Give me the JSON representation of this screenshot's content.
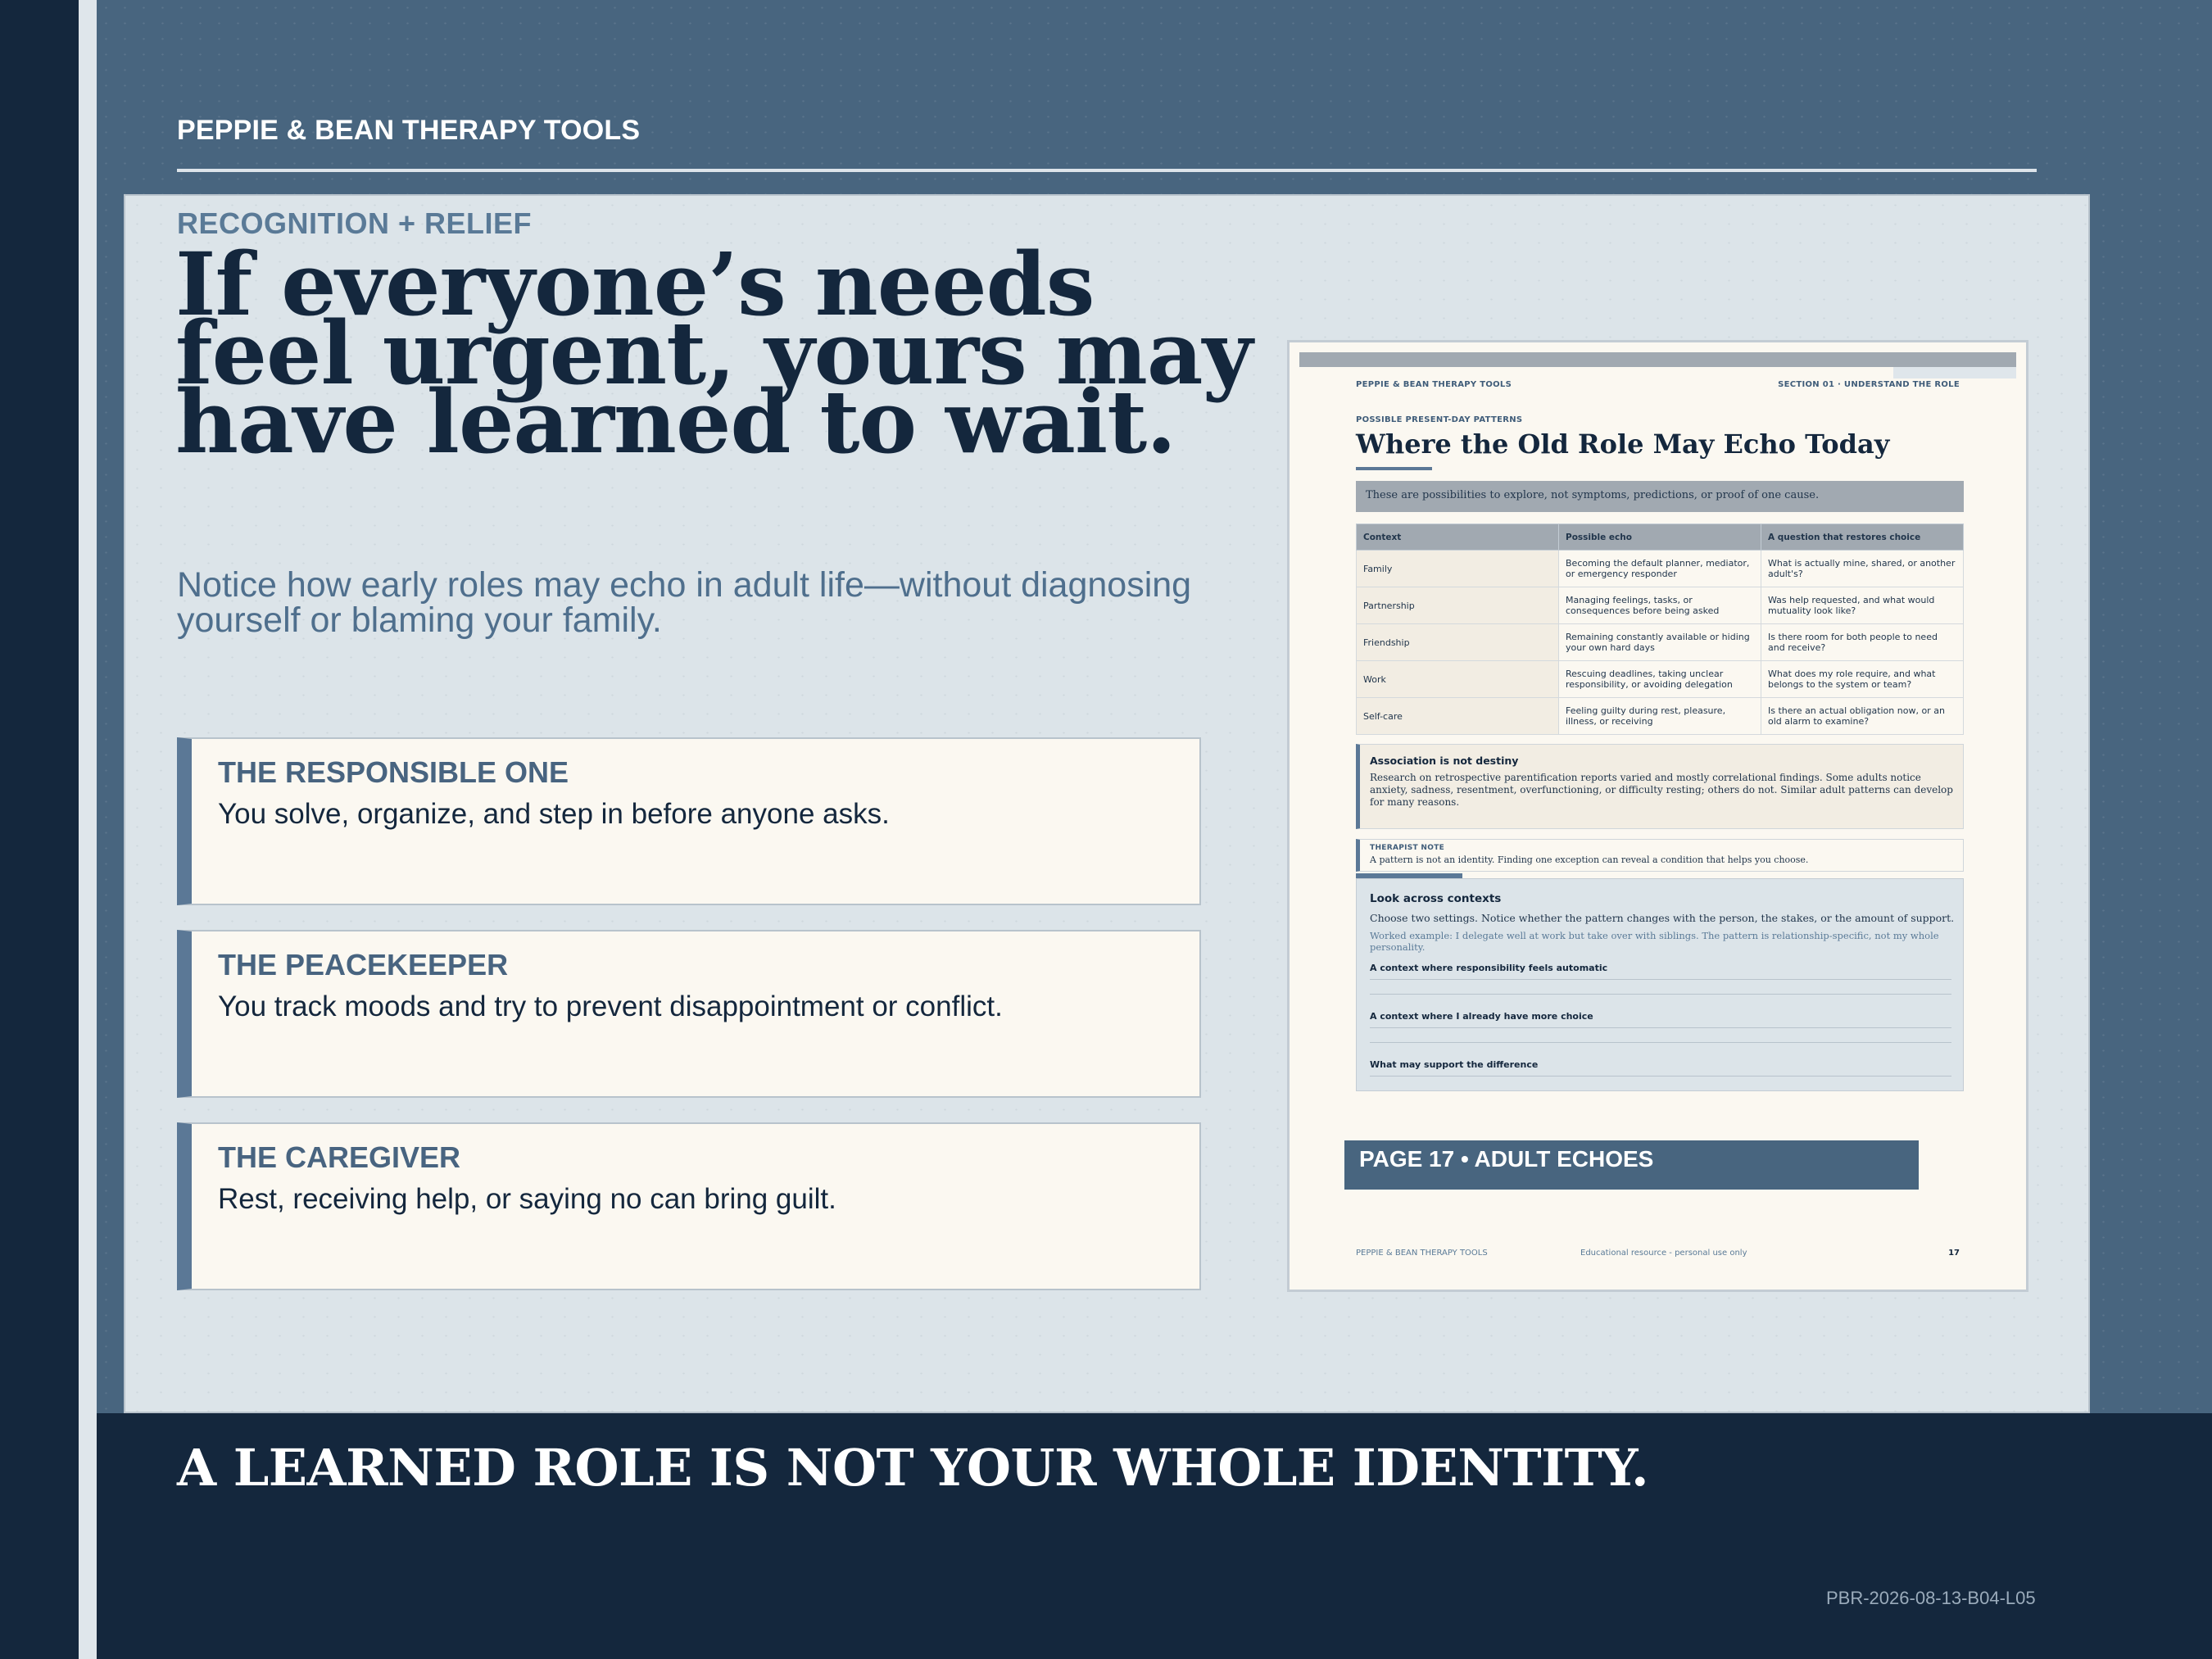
{
  "brand": "PEPPIE & BEAN THERAPY TOOLS",
  "kicker": "RECOGNITION + RELIEF",
  "headline": "If everyone’s needs feel urgent, yours may have learned to wait.",
  "subhead": "Notice how early roles may echo in adult life—without diagnosing yourself or blaming your family.",
  "cards": [
    {
      "title": "THE RESPONSIBLE ONE",
      "text": "You solve, organize, and step in before anyone asks."
    },
    {
      "title": "THE PEACEKEEPER",
      "text": "You track moods and try to prevent disappointment or conflict."
    },
    {
      "title": "THE CAREGIVER",
      "text": "Rest, receiving help, or saying no can bring guilt."
    }
  ],
  "doc": {
    "header_left": "PEPPIE & BEAN THERAPY TOOLS",
    "header_right": "SECTION 01 · UNDERSTAND THE ROLE",
    "eyebrow": "POSSIBLE PRESENT-DAY PATTERNS",
    "title": "Where the Old Role May Echo Today",
    "note": "These are possibilities to explore, not symptoms, predictions, or proof of one cause.",
    "table_headers": [
      "Context",
      "Possible echo",
      "A question that restores choice"
    ],
    "table_rows": [
      [
        "Family",
        "Becoming the default planner, mediator, or emergency responder",
        "What is actually mine, shared, or another adult's?"
      ],
      [
        "Partnership",
        "Managing feelings, tasks, or consequences before being asked",
        "Was help requested, and what would mutuality look like?"
      ],
      [
        "Friendship",
        "Remaining constantly available or hiding your own hard days",
        "Is there room for both people to need and receive?"
      ],
      [
        "Work",
        "Rescuing deadlines, taking unclear responsibility, or avoiding delegation",
        "What does my role require, and what belongs to the system or team?"
      ],
      [
        "Self-care",
        "Feeling guilty during rest, pleasure, illness, or receiving",
        "Is there an actual obligation now, or an old alarm to examine?"
      ]
    ],
    "association_title": "Association is not destiny",
    "association_body": "Research on retrospective parentification reports varied and mostly correlational findings. Some adults notice anxiety, sadness, resentment, overfunctioning, or difficulty resting; others do not. Similar adult patterns can develop for many reasons.",
    "therapist_label": "THERAPIST NOTE",
    "therapist_body": "A pattern is not an identity. Finding one exception can reveal a condition that helps you choose.",
    "look_title": "Look across contexts",
    "look_body": "Choose two settings. Notice whether the pattern changes with the person, the stakes, or the amount of support.",
    "look_example": "Worked example: I delegate well at work but take over with siblings. The pattern is relationship-specific, not my whole personality.",
    "prompts": [
      "A context where responsibility feels automatic",
      "A context where I already have more choice",
      "What may support the difference"
    ],
    "page_bar": "PAGE 17 • ADULT ECHOES",
    "footer_left": "PEPPIE & BEAN THERAPY TOOLS",
    "footer_center": "Educational resource - personal use only",
    "footer_page": "17"
  },
  "tagline": "A LEARNED ROLE IS NOT YOUR WHOLE IDENTITY.",
  "code": "PBR-2026-08-13-B04-L05",
  "colors": {
    "navy": "#14273d",
    "slate": "#48657f",
    "accent": "#5b7896",
    "paper": "#fbf8f1",
    "panel": "#dce4e9"
  }
}
